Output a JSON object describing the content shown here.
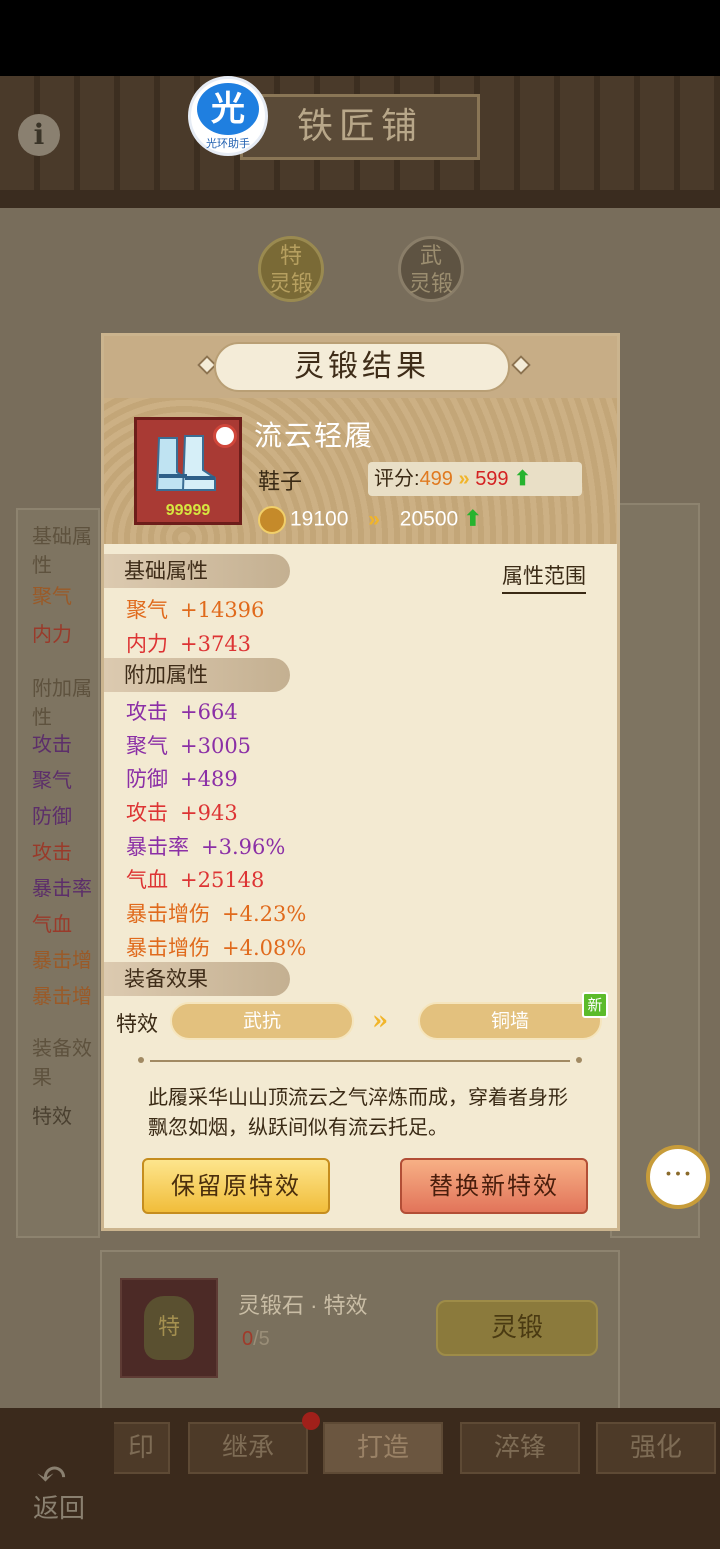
{
  "header": {
    "title": "铁匠铺",
    "info_icon": "info-icon"
  },
  "helper_logo": {
    "glyph": "光",
    "caption": "光环助手"
  },
  "background": {
    "forge_tabs": [
      {
        "top": "特",
        "bottom": "灵锻"
      },
      {
        "top": "武",
        "bottom": "灵锻"
      }
    ],
    "left_panel": {
      "sections": [
        "基础属性",
        "附加属性",
        "装备效果"
      ],
      "attrs": [
        "聚气",
        "内力",
        "攻击",
        "聚气",
        "防御",
        "攻击",
        "暴击率",
        "气血",
        "暴击增",
        "暴击增"
      ],
      "effect_label": "特效"
    },
    "craft": {
      "stone_glyph": "特",
      "label": "灵锻石 · 特效",
      "count_have": "0",
      "count_total": "/5",
      "button": "灵锻"
    }
  },
  "bottom_tabs": [
    "印",
    "继承",
    "打造",
    "淬锋",
    "强化"
  ],
  "back_label": "返回",
  "dialog": {
    "title": "灵锻结果",
    "item": {
      "name": "流云轻履",
      "type": "鞋子",
      "quantity": "99999",
      "score_label": "评分:",
      "score_old": "499",
      "score_new": "599",
      "power_old": "19100",
      "power_new": "20500"
    },
    "range_link": "属性范围",
    "sections": {
      "base": "基础属性",
      "extra": "附加属性",
      "effect": "装备效果"
    },
    "base_attrs": [
      {
        "name": "聚气",
        "value": "+14396"
      },
      {
        "name": "内力",
        "value": "+3743"
      }
    ],
    "extra_attrs": [
      {
        "name": "攻击",
        "value": "+664"
      },
      {
        "name": "聚气",
        "value": "+3005"
      },
      {
        "name": "防御",
        "value": "+489"
      },
      {
        "name": "攻击",
        "value": "+943"
      },
      {
        "name": "暴击率",
        "value": "+3.96%"
      },
      {
        "name": "气血",
        "value": "+25148"
      },
      {
        "name": "暴击增伤",
        "value": "+4.23%"
      },
      {
        "name": "暴击增伤",
        "value": "+4.08%"
      }
    ],
    "effect": {
      "label": "特效",
      "old": "武抗",
      "new": "铜墙",
      "new_badge": "新"
    },
    "description": "此履采华山山顶流云之气淬炼而成，穿着者身形飘忽如烟，纵跃间似有流云托足。",
    "buttons": {
      "keep": "保留原特效",
      "replace": "替换新特效"
    }
  },
  "colors": {
    "attr_orange": "#e06a1c",
    "attr_red": "#dd3434",
    "attr_purple": "#8b2fa6",
    "score_up": "#27b32e"
  }
}
